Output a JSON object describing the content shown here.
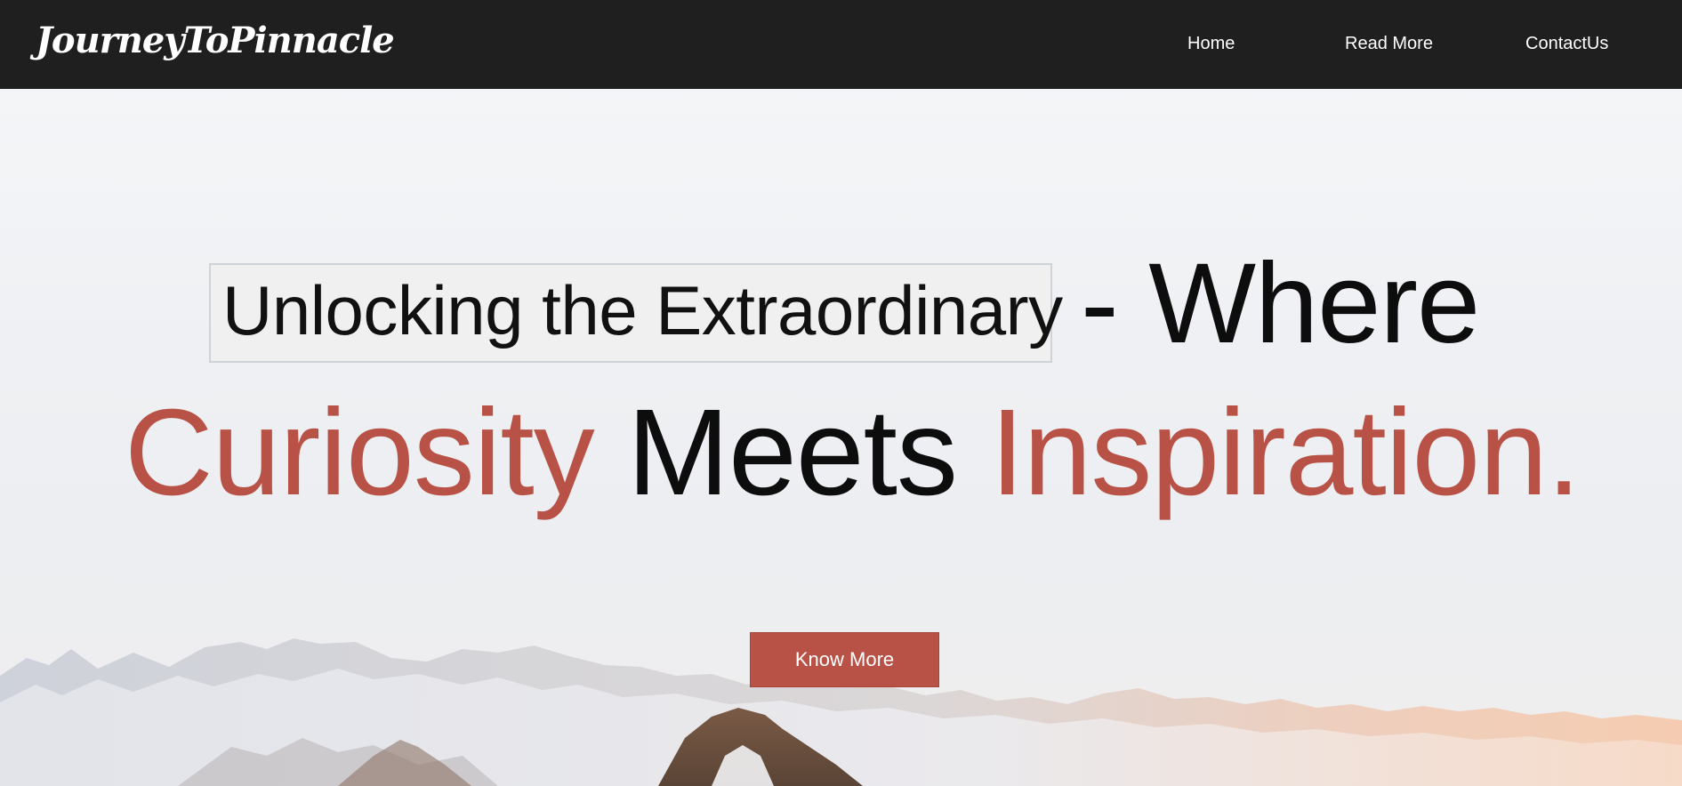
{
  "brand": {
    "name": "JourneyToPinnacle"
  },
  "nav": {
    "home": "Home",
    "read_more": "Read More",
    "contact": "ContactUs"
  },
  "hero": {
    "highlight": "Unlocking the Extraordinary",
    "line1_rest": "- Where",
    "line2": {
      "word1": "Curiosity",
      "word2": "Meets",
      "word3": "Inspiration."
    },
    "cta_label": "Know More"
  },
  "colors": {
    "navbar": "#1f1f1f",
    "accent": "#b95246",
    "text_dark": "#0d0d0d"
  }
}
